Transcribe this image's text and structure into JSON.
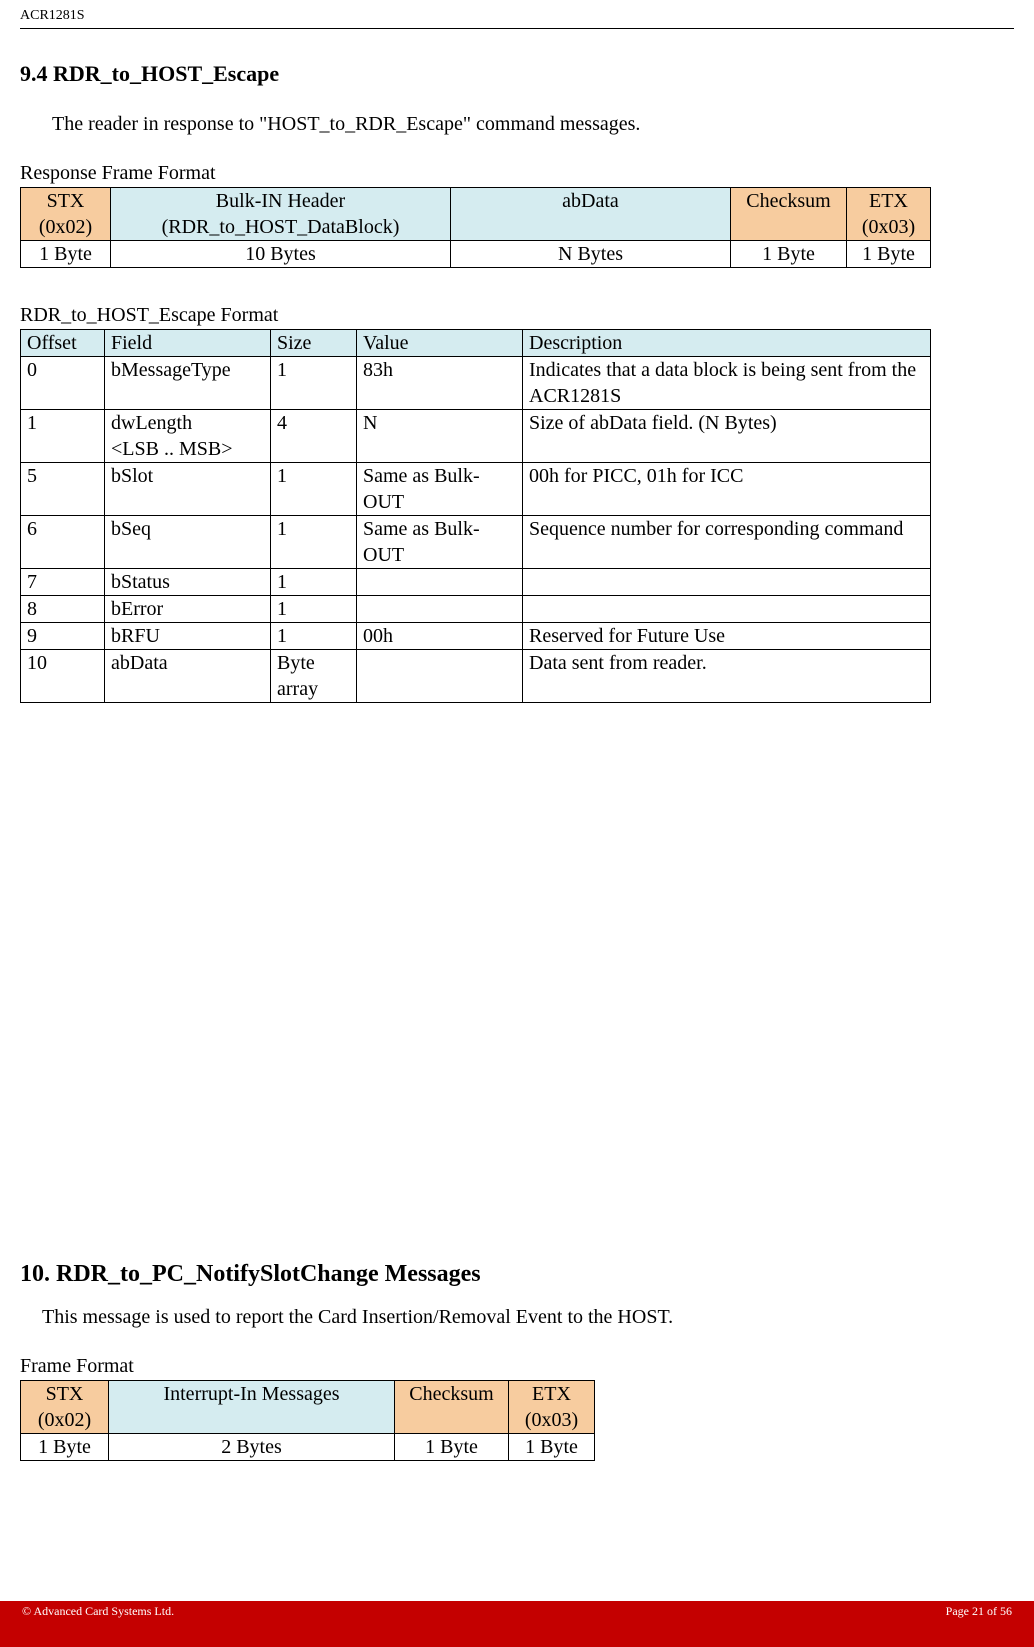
{
  "header": {
    "doc_id": "ACR1281S"
  },
  "section1": {
    "heading": "9.4 RDR_to_HOST_Escape",
    "paragraph": "The reader in response to \"HOST_to_RDR_Escape\" command messages.",
    "table1_title": "Response Frame Format",
    "t1": {
      "h1a": "STX",
      "h1b": "(0x02)",
      "h2a": "Bulk-IN Header",
      "h2b": "(RDR_to_HOST_DataBlock)",
      "h3": "abData",
      "h4": "Checksum",
      "h5a": "ETX",
      "h5b": "(0x03)",
      "r1": "1 Byte",
      "r2": "10 Bytes",
      "r3": "N Bytes",
      "r4": "1 Byte",
      "r5": "1 Byte"
    },
    "table2_title": "RDR_to_HOST_Escape Format",
    "t2": {
      "h": {
        "c1": "Offset",
        "c2": "Field",
        "c3": "Size",
        "c4": "Value",
        "c5": "Description"
      },
      "rows": [
        {
          "c1": "0",
          "c2": "bMessageType",
          "c3": "1",
          "c4": "83h",
          "c5": "Indicates that a data block is being sent from the ACR1281S"
        },
        {
          "c1": "1",
          "c2": "dwLength\n<LSB .. MSB>",
          "c3": "4",
          "c4": "N",
          "c5": "Size of abData field. (N Bytes)"
        },
        {
          "c1": "5",
          "c2": "bSlot",
          "c3": "1",
          "c4": "Same as Bulk-OUT",
          "c5": "00h for PICC, 01h for ICC"
        },
        {
          "c1": "6",
          "c2": "bSeq",
          "c3": "1",
          "c4": "Same as Bulk-OUT",
          "c5": "Sequence number for corresponding command"
        },
        {
          "c1": "7",
          "c2": "bStatus",
          "c3": "1",
          "c4": "",
          "c5": ""
        },
        {
          "c1": "8",
          "c2": "bError",
          "c3": "1",
          "c4": "",
          "c5": ""
        },
        {
          "c1": "9",
          "c2": "bRFU",
          "c3": "1",
          "c4": "00h",
          "c5": "Reserved for Future Use"
        },
        {
          "c1": "10",
          "c2": "abData",
          "c3": "Byte array",
          "c4": "",
          "c5": "Data sent from reader."
        }
      ]
    }
  },
  "section2": {
    "heading": "10.  RDR_to_PC_NotifySlotChange Messages",
    "paragraph": "This message is used to report the Card Insertion/Removal Event to the HOST.",
    "table_title": "Frame Format",
    "t3": {
      "h1a": "STX",
      "h1b": "(0x02)",
      "h2": "Interrupt-In Messages",
      "h3": "Checksum",
      "h4a": "ETX",
      "h4b": "(0x03)",
      "r1": "1 Byte",
      "r2": "2 Bytes",
      "r3": "1 Byte",
      "r4": "1 Byte"
    }
  },
  "footer": {
    "left": "© Advanced Card Systems Ltd.",
    "right": "Page 21 of 56"
  }
}
